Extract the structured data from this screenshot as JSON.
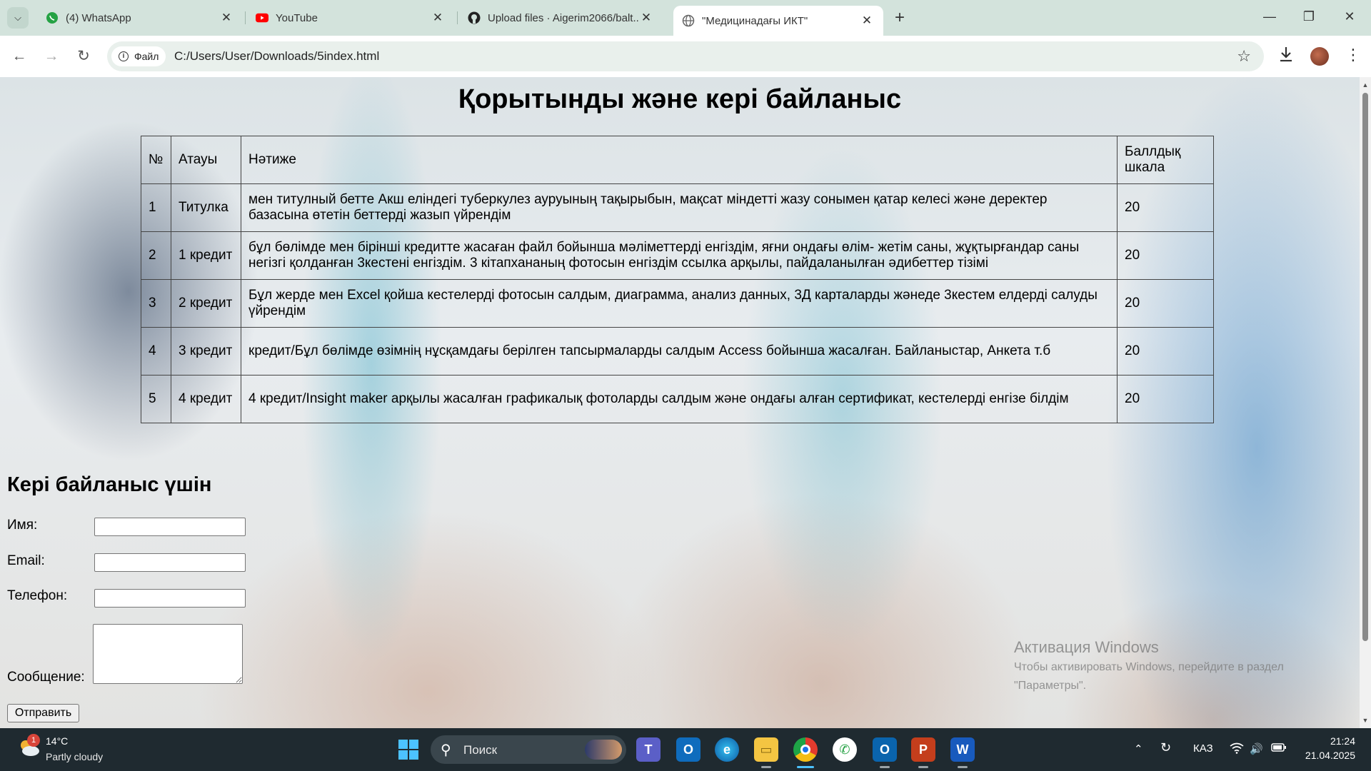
{
  "browser": {
    "tabs": [
      {
        "title": "(4) WhatsApp",
        "icon": "whatsapp-icon"
      },
      {
        "title": "YouTube",
        "icon": "youtube-icon"
      },
      {
        "title": "Upload files · Aigerim2066/balt...",
        "icon": "github-icon"
      },
      {
        "title": "\"Медицинадағы ИКТ\"",
        "icon": "globe-icon"
      }
    ],
    "address": {
      "chip_label": "Файл",
      "url": "C:/Users/User/Downloads/5index.html"
    }
  },
  "page": {
    "title": "Қорытынды және кері байланыс",
    "table": {
      "headers": [
        "№",
        "Атауы",
        "Нәтиже",
        "Баллдық шкала"
      ],
      "rows": [
        {
          "num": "1",
          "name": "Титулка",
          "result": "мен титулный бетте Акш еліндегі туберкулез ауруының тақырыбын, мақсат міндетті жазу сонымен қатар келесі және деректер базасына өтетін беттерді жазып үйрендім",
          "score": "20"
        },
        {
          "num": "2",
          "name": "1 кредит",
          "result": "бұл бөлімде мен бірінші кредитте жасаған файл бойынша мәліметтерді енгіздім, яғни ондағы өлім- жетім саны, жұқтырғандар саны негізгі қолданған 3кестені енгіздім. 3 кітапхананың фотосын енгіздім ссылка арқылы, пайдаланылған әдибеттер тізімі",
          "score": "20"
        },
        {
          "num": "3",
          "name": "2 кредит",
          "result": "Бұл жерде мен Excel қойша кестелерді фотосын салдым, диаграмма, анализ данных, 3Д карталарды жәнеде 3кестем елдерді салуды үйрендім",
          "score": "20"
        },
        {
          "num": "4",
          "name": "3 кредит",
          "result": "кредит/Бұл бөлімде өзімнің нұсқамдағы берілген тапсырмаларды салдым Access бойынша жасалған. Байланыстар, Анкета т.б",
          "score": "20"
        },
        {
          "num": "5",
          "name": "4 кредит",
          "result": "4 кредит/Insight maker арқылы жасалған графикалық фотоларды салдым және ондағы алған сертификат, кестелерді енгізе білдім",
          "score": "20"
        }
      ]
    },
    "feedback": {
      "title": "Кері байланыс үшін",
      "name_label": "Имя:",
      "email_label": "Email:",
      "phone_label": "Телефон:",
      "message_label": "Сообщение:",
      "submit_label": "Отправить"
    },
    "watermark": {
      "line1": "Активация Windows",
      "line2": "Чтобы активировать Windows, перейдите в раздел",
      "line3": "\"Параметры\"."
    }
  },
  "taskbar": {
    "weather": {
      "badge": "1",
      "temp": "14°C",
      "desc": "Partly cloudy"
    },
    "search_placeholder": "Поиск",
    "language": "КАЗ",
    "time": "21:24",
    "date": "21.04.2025"
  },
  "colors": {
    "tabbar": "#d3e3dc",
    "taskbar": "#1f2a30",
    "accent": "#2e7d5b"
  }
}
